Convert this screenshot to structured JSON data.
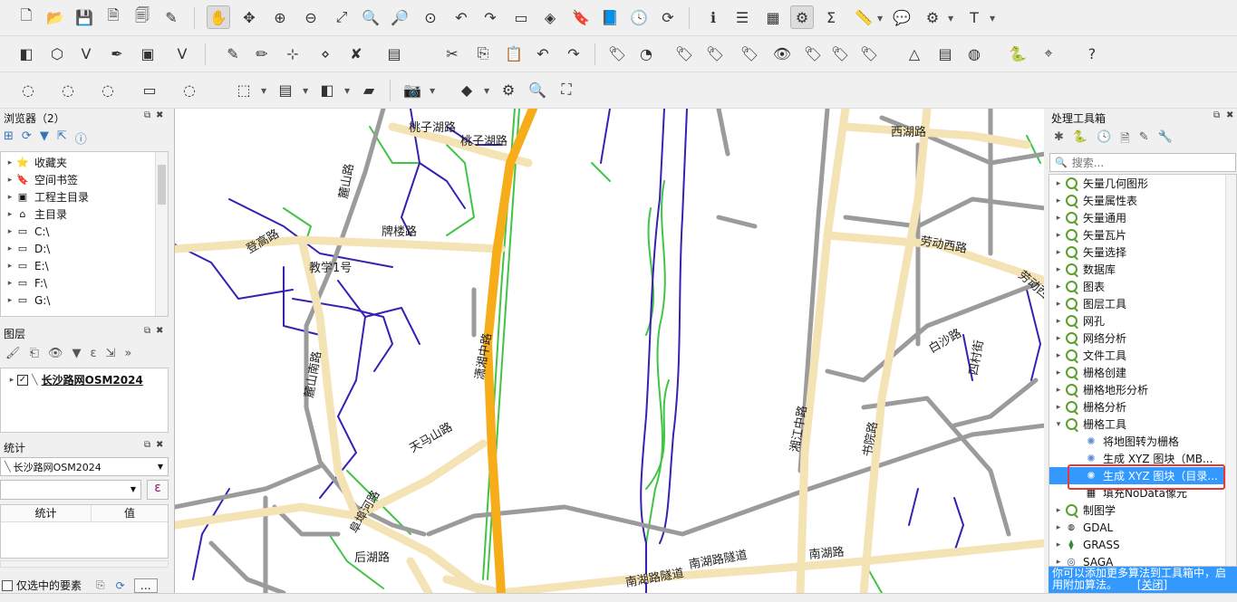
{
  "browser_panel": {
    "title": "浏览器（2）",
    "items": [
      {
        "label": "收藏夹",
        "icon": "star-icon"
      },
      {
        "label": "空间书签",
        "icon": "bookmark-icon"
      },
      {
        "label": "工程主目录",
        "icon": "project-home-icon"
      },
      {
        "label": "主目录",
        "icon": "home-icon"
      },
      {
        "label": "C:\\",
        "icon": "drive-icon"
      },
      {
        "label": "D:\\",
        "icon": "drive-icon"
      },
      {
        "label": "E:\\",
        "icon": "drive-icon"
      },
      {
        "label": "F:\\",
        "icon": "drive-icon"
      },
      {
        "label": "G:\\",
        "icon": "drive-icon"
      }
    ]
  },
  "layers_panel": {
    "title": "图层",
    "layers": [
      {
        "name": "长沙路网OSM2024",
        "checked": true
      }
    ]
  },
  "stats_panel": {
    "title": "统计",
    "layer_select": "长沙路网OSM2024",
    "field_input": "",
    "col_stat": "统计",
    "col_value": "值",
    "only_selected_label": "仅选中的要素"
  },
  "toolbox_panel": {
    "title": "处理工具箱",
    "search_placeholder": "搜索...",
    "groups": [
      {
        "label": "矢量几何图形"
      },
      {
        "label": "矢量属性表"
      },
      {
        "label": "矢量通用"
      },
      {
        "label": "矢量瓦片"
      },
      {
        "label": "矢量选择"
      },
      {
        "label": "数据库"
      },
      {
        "label": "图表"
      },
      {
        "label": "图层工具"
      },
      {
        "label": "网孔"
      },
      {
        "label": "网络分析"
      },
      {
        "label": "文件工具"
      },
      {
        "label": "栅格创建"
      },
      {
        "label": "栅格地形分析"
      },
      {
        "label": "栅格分析"
      },
      {
        "label": "栅格工具"
      }
    ],
    "raster_tools": [
      {
        "label": "将地图转为栅格"
      },
      {
        "label": "生成 XYZ 图块（MB..."
      },
      {
        "label": "生成 XYZ 图块（目录..."
      },
      {
        "label": "填充NoData像元"
      }
    ],
    "more_groups": [
      {
        "label": "制图学"
      },
      {
        "label": "GDAL"
      },
      {
        "label": "GRASS"
      },
      {
        "label": "SAGA"
      }
    ],
    "notice_text": "你可以添加更多算法到工具箱中，启用附加算法。",
    "notice_close": "[关闭]"
  },
  "map": {
    "labels": [
      {
        "text": "桃子湖路"
      },
      {
        "text": "桃子湖路"
      },
      {
        "text": "牌楼路"
      },
      {
        "text": "登高路"
      },
      {
        "text": "教学1号"
      },
      {
        "text": "麓山路"
      },
      {
        "text": "麓山南路"
      },
      {
        "text": "潇湘中路"
      },
      {
        "text": "天马山路"
      },
      {
        "text": "阜埠河路"
      },
      {
        "text": "后湖路"
      },
      {
        "text": "南湖路隧道"
      },
      {
        "text": "南湖路隧道"
      },
      {
        "text": "南湖路"
      },
      {
        "text": "湘江中路"
      },
      {
        "text": "西湖路"
      },
      {
        "text": "劳动西路"
      },
      {
        "text": "白沙路"
      },
      {
        "text": "书院路"
      },
      {
        "text": "四村街"
      },
      {
        "text": "劳动西路"
      }
    ],
    "colors": {
      "major": "#f4e3b4",
      "trunk": "#f7ad1a",
      "minor": "#9b9b9b",
      "path": "#3a1fb3",
      "foot": "#41c446"
    }
  },
  "colors": {
    "accent": "#3399ff",
    "highlight_box": "#e53935"
  }
}
